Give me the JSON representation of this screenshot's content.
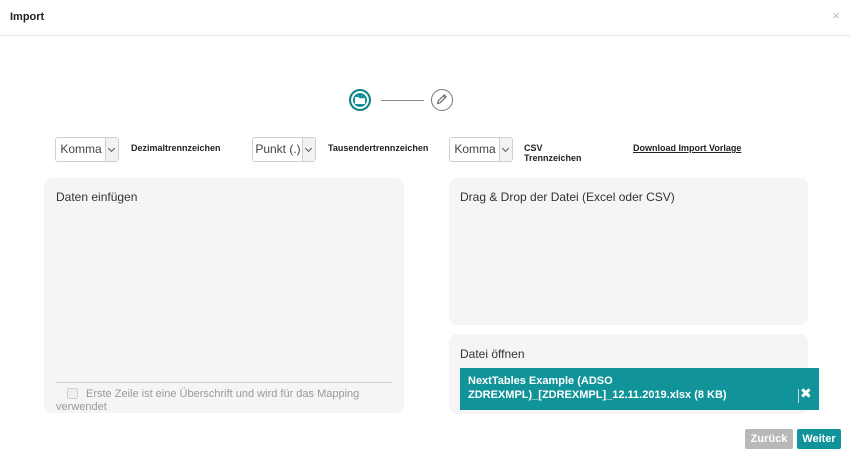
{
  "dialog": {
    "title": "Import",
    "close_label": "×"
  },
  "stepper": {
    "steps": [
      {
        "icon": "folder-icon",
        "active": true
      },
      {
        "icon": "pencil-icon",
        "active": false
      }
    ],
    "accent": "#11939a"
  },
  "options": {
    "decimal": {
      "value": "Komma",
      "label": "Dezimaltrennzeichen"
    },
    "thousands": {
      "value": "Punkt (.)",
      "label": "Tausendertrennzeichen"
    },
    "csv": {
      "value": "Komma",
      "label_line1": "CSV",
      "label_line2": "Trennzeichen"
    },
    "download_link": "Download Import Vorlage"
  },
  "paste_panel": {
    "title": "Daten einfügen",
    "checkbox_label": "Erste Zeile ist eine Überschrift und wird für das Mapping verwendet"
  },
  "drop_panel": {
    "title": "Drag & Drop der Datei (Excel oder CSV)"
  },
  "open_panel": {
    "title": "Datei öffnen",
    "file_name": "NextTables Example (ADSO ZDREXMPL)_[ZDREXMPL]_12.11.2019.xlsx (8 KB)",
    "remove_label": "✖"
  },
  "footer": {
    "back_label": "Zurück",
    "next_label": "Weiter"
  }
}
